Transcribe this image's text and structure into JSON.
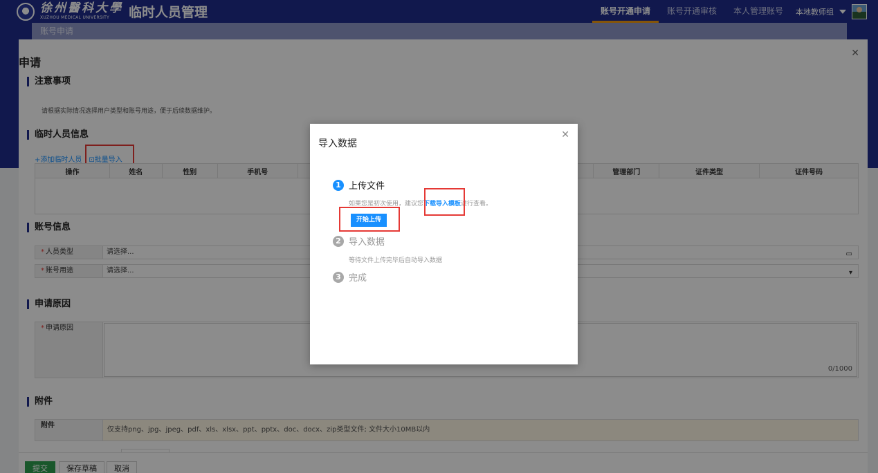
{
  "header": {
    "logo_cn": "徐州醫科大學",
    "logo_en": "XUZHOU MEDICAL UNIVERSITY",
    "app_title": "临时人员管理",
    "nav": [
      {
        "label": "账号开通申请"
      },
      {
        "label": "账号开通审核"
      },
      {
        "label": "本人管理账号"
      }
    ],
    "user_name": "本地教师组"
  },
  "tab": {
    "label": "账号申请"
  },
  "form": {
    "title": "申请",
    "notice_title": "注意事项",
    "notice_text": "请根据实际情况选择用户类型和账号用途，便于后续数据维护。",
    "temp_title": "临时人员信息",
    "add_link": "+添加临时人员",
    "batch_link": "⊡批量导入",
    "columns": [
      "操作",
      "姓名",
      "性别",
      "手机号",
      "",
      "管理部门",
      "证件类型",
      "证件号码"
    ],
    "account_title": "账号信息",
    "person_type_label": "人员类型",
    "person_type_value": "请选择...",
    "account_use_label": "账号用途",
    "account_use_value": "请选择...",
    "reason_title": "申请原因",
    "reason_label": "申请原因",
    "reason_counter": "0/1000",
    "attach_title": "附件",
    "attach_label": "附件",
    "attach_hint": "仅支持png、jpg、jpeg、pdf、xls、xlsx、ppt、pptx、doc、docx、zip类型文件; 文件大小10MB以内",
    "submit": "提交",
    "save_draft": "保存草稿",
    "cancel": "取消"
  },
  "modal": {
    "title": "导入数据",
    "step1_num": "1",
    "step1_title": "上传文件",
    "step1_desc_pre": "如果您是初次使用，建议您",
    "step1_link": "下载导入模板",
    "step1_desc_post": "进行查看。",
    "upload_button": "开始上传",
    "step2_num": "2",
    "step2_title": "导入数据",
    "step2_desc": "等待文件上传完毕后自动导入数据",
    "step3_num": "3",
    "step3_title": "完成"
  },
  "colors": {
    "header_bg": "#1f2c8c",
    "accent": "#1890ff",
    "highlight": "#e53935",
    "submit": "#2e9e4f"
  }
}
